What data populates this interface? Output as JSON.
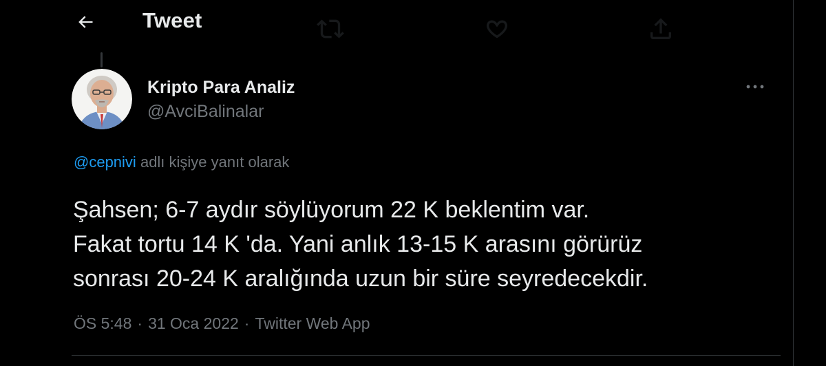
{
  "header": {
    "title": "Tweet",
    "back_icon": "arrow-left-icon"
  },
  "author": {
    "display_name": "Kripto Para Analiz",
    "handle": "@AvciBalinalar",
    "avatar_icon": "profile-photo"
  },
  "reply_context": {
    "mention": "@cepnivi",
    "text": "adlı kişiye yanıt olarak"
  },
  "tweet": {
    "lines": [
      "Şahsen; 6-7 aydır söylüyorum 22 K beklentim var.",
      "Fakat tortu 14 K 'da. Yani anlık 13-15 K arasını görürüz",
      "sonrası 20-24 K aralığında uzun bir süre seyredecekdir."
    ]
  },
  "meta": {
    "time": "ÖS 5:48",
    "separator": "·",
    "date": "31 Oca 2022",
    "source": "Twitter Web App"
  },
  "colors": {
    "background": "#000000",
    "text_primary": "#e7e9ea",
    "text_secondary": "#71767b",
    "accent": "#1d9bf0",
    "border": "#2f3336"
  },
  "icons": {
    "more": "more-horizontal-icon",
    "ghost_retweet": "retweet-icon",
    "ghost_like": "heart-icon",
    "ghost_share": "share-icon"
  }
}
